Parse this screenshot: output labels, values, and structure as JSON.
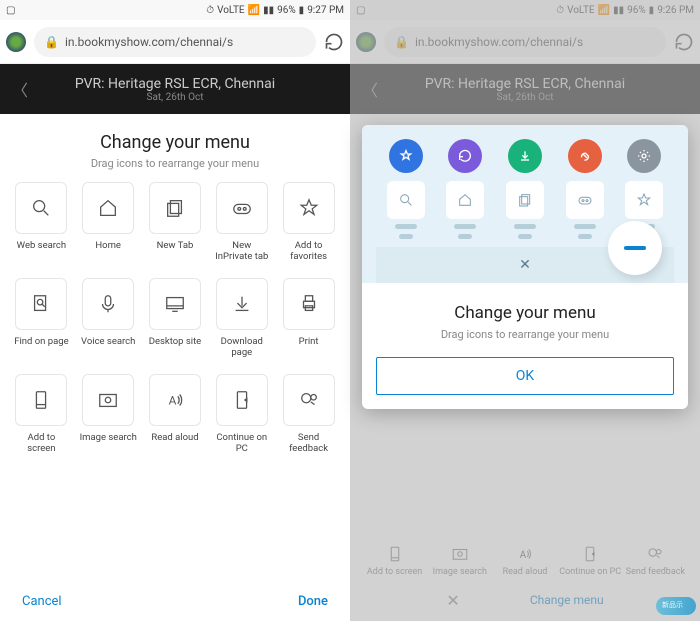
{
  "left": {
    "status": {
      "time": "9:27 PM",
      "battery": "96%",
      "net": "VoLTE"
    },
    "url": "in.bookmyshow.com/chennai/s",
    "header": {
      "title": "PVR: Heritage RSL ECR, Chennai",
      "date": "Sat, 26th Oct"
    },
    "sheet": {
      "title": "Change your menu",
      "subtitle": "Drag icons to rearrange your menu",
      "tiles": [
        {
          "name": "web-search",
          "label": "Web search"
        },
        {
          "name": "home",
          "label": "Home"
        },
        {
          "name": "new-tab",
          "label": "New Tab"
        },
        {
          "name": "inprivate",
          "label": "New InPrivate tab"
        },
        {
          "name": "favorites",
          "label": "Add to favorites"
        },
        {
          "name": "find",
          "label": "Find on page"
        },
        {
          "name": "voice",
          "label": "Voice search"
        },
        {
          "name": "desktop",
          "label": "Desktop site"
        },
        {
          "name": "download",
          "label": "Download page"
        },
        {
          "name": "print",
          "label": "Print"
        },
        {
          "name": "addscreen",
          "label": "Add to screen"
        },
        {
          "name": "imgsearch",
          "label": "Image search"
        },
        {
          "name": "readaloud",
          "label": "Read aloud"
        },
        {
          "name": "continuepc",
          "label": "Continue on PC"
        },
        {
          "name": "feedback",
          "label": "Send feedback"
        }
      ],
      "cancel": "Cancel",
      "done": "Done"
    }
  },
  "right": {
    "status": {
      "time": "9:26 PM",
      "battery": "96%",
      "net": "VoLTE"
    },
    "url": "in.bookmyshow.com/chennai/s",
    "header": {
      "title": "PVR: Heritage RSL ECR, Chennai",
      "date": "Sat, 26th Oct"
    },
    "modal": {
      "title": "Change your menu",
      "subtitle": "Drag icons to rearrange your menu",
      "ok": "OK",
      "circle_colors": [
        "#2f74e0",
        "#7b5bdc",
        "#18b27a",
        "#e5613f",
        "#8b95a0"
      ]
    },
    "ghost_tiles": [
      {
        "label": "Add to screen"
      },
      {
        "label": "Image search"
      },
      {
        "label": "Read aloud"
      },
      {
        "label": "Continue on PC"
      },
      {
        "label": "Send feedback"
      }
    ],
    "footer": {
      "close": "×",
      "change": "Change menu"
    }
  }
}
